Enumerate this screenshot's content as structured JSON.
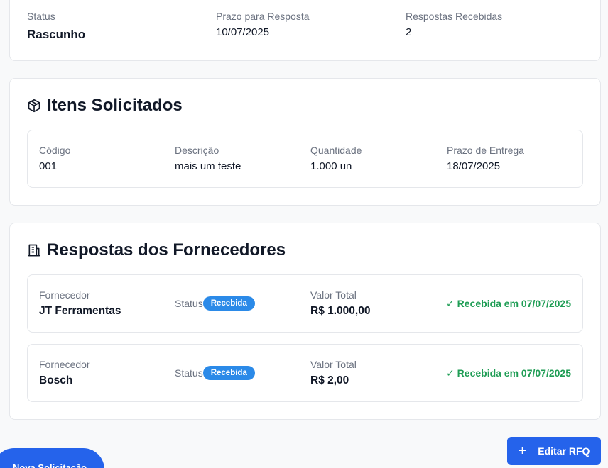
{
  "summary": {
    "status_label": "Status",
    "status_value": "Rascunho",
    "deadline_label": "Prazo para Resposta",
    "deadline_value": "10/07/2025",
    "responses_label": "Respostas Recebidas",
    "responses_value": "2"
  },
  "items_section": {
    "title": "Itens Solicitados",
    "icon": "package-icon",
    "headers": [
      "Código",
      "Descrição",
      "Quantidade",
      "Prazo de Entrega"
    ],
    "row": [
      "001",
      "mais um teste",
      "1.000 un",
      "18/07/2025"
    ]
  },
  "responses_section": {
    "title": "Respostas dos Fornecedores",
    "icon": "building-icon",
    "supplier_label": "Fornecedor",
    "status_label": "Status",
    "total_label": "Valor Total",
    "responses": [
      {
        "supplier": "JT Ferramentas",
        "status": "Recebida",
        "total": "R$ 1.000,00",
        "received": "✓ Recebida em 07/07/2025"
      },
      {
        "supplier": "Bosch",
        "status": "Recebida",
        "total": "R$ 2,00",
        "received": "✓ Recebida em 07/07/2025"
      }
    ]
  },
  "actions": {
    "new_request": "Nova Solicitação",
    "edit_rfq": "Editar RFQ",
    "accent": "#2563eb",
    "badge_color": "#2b8ae8",
    "received_color": "#1f9d55"
  }
}
